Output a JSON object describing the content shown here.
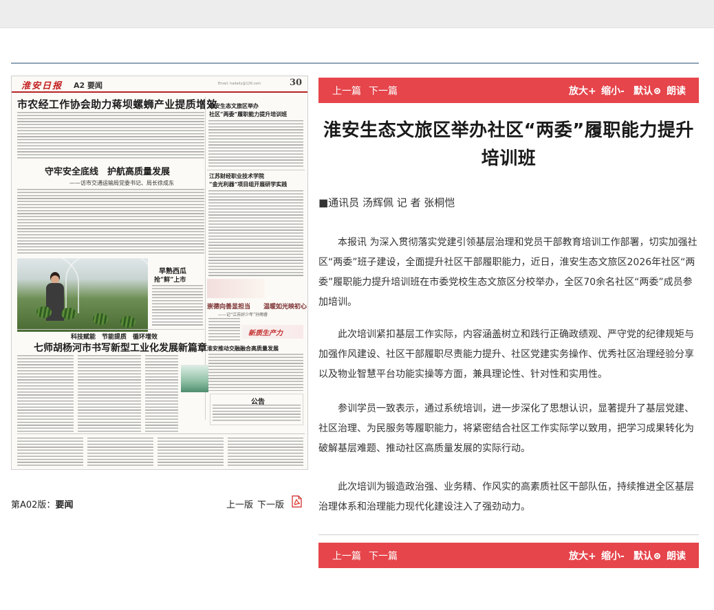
{
  "newspaper": {
    "logo": "淮安日报",
    "edition": "A2 要闻",
    "header_info": "Email: hadaily@126.com",
    "page_num": "30",
    "headlines": {
      "main": "市农经工作协会助力蒋坝螺蛳产业提质增效",
      "second": "守牢安全底线　护航高质量发展",
      "second_sub": "——访市交通运输局党委书记、局长徐成东",
      "right1": "淮安生态文旅区举办",
      "right2": "社区“两委”履职能力提升培训班",
      "right3": "江苏财经职业技术学院",
      "right4": "“金光利器”项目组开展研学实践",
      "right5": "崇德向善显担当",
      "right6": "温暖如光映初心",
      "right7": "——记“江苏好少年”孙雨睿",
      "photo_title": "早熟西瓜",
      "photo_title2": "抢“鲜”上市",
      "slogan": "科技赋能　节能提质　循环增效",
      "third": "七师胡杨河市书写新型工业化发展新篇章",
      "right8": "淮安推动交融融合高质量发展",
      "notice": "公告",
      "banner": "新质生产力"
    }
  },
  "page_caption": {
    "prefix": "第A02版：",
    "section": "要闻"
  },
  "pager": {
    "prev": "上一版",
    "next": "下一版"
  },
  "toolbar": {
    "prev": "上一篇",
    "next": "下一篇",
    "zoom_in": "放大+",
    "zoom_out": "缩小-",
    "default": "默认",
    "read": "朗读"
  },
  "article": {
    "title": "淮安生态文旅区举办社区“两委”履职能力提升培训班",
    "byline": "■通讯员 汤辉佩 记 者 张桐恺",
    "paragraphs": [
      "本报讯 为深入贯彻落实党建引领基层治理和党员干部教育培训工作部署，切实加强社区“两委”班子建设，全面提升社区干部履职能力，近日，淮安生态文旅区2026年社区“两委”履职能力提升培训班在市委党校生态文旅区分校举办，全区70余名社区“两委”成员参加培训。",
      "此次培训紧扣基层工作实际，内容涵盖树立和践行正确政绩观、严守党的纪律规矩与加强作风建设、社区干部履职尽责能力提升、社区党建实务操作、优秀社区治理经验分享以及物业智慧平台功能实操等方面，兼具理论性、针对性和实用性。",
      "参训学员一致表示，通过系统培训，进一步深化了思想认识，显著提升了基层党建、社区治理、为民服务等履职能力，将紧密结合社区工作实际学以致用，把学习成果转化为破解基层难题、推动社区高质量发展的实际行动。",
      "此次培训为锻造政治强、业务精、作风实的高素质社区干部队伍，持续推进全区基层治理体系和治理能力现代化建设注入了强劲动力。"
    ]
  },
  "colors": {
    "toolbar_bg": "#e5454b",
    "rule": "#8fa3b6"
  }
}
